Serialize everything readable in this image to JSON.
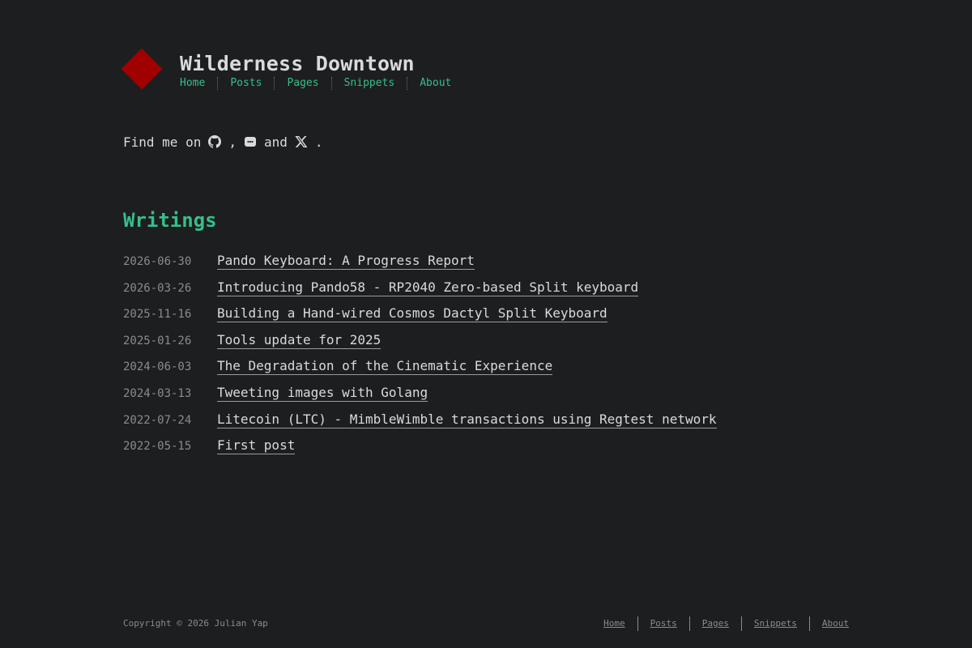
{
  "site": {
    "title": "Wilderness Downtown",
    "logo_color": "#a00000",
    "accent_color": "#35bf8a",
    "background_color": "#1d1e20"
  },
  "nav": {
    "items": [
      {
        "label": "Home"
      },
      {
        "label": "Posts"
      },
      {
        "label": "Pages"
      },
      {
        "label": "Snippets"
      },
      {
        "label": "About"
      }
    ]
  },
  "findme": {
    "prefix": "Find me on",
    "sep_comma": ",",
    "sep_and": "and",
    "suffix": ".",
    "icons": [
      "github-icon",
      "discord-icon",
      "x-icon"
    ]
  },
  "writings": {
    "heading": "Writings",
    "posts": [
      {
        "date": "2026-06-30",
        "title": "Pando Keyboard: A Progress Report"
      },
      {
        "date": "2026-03-26",
        "title": "Introducing Pando58 - RP2040 Zero-based Split keyboard"
      },
      {
        "date": "2025-11-16",
        "title": "Building a Hand-wired Cosmos Dactyl Split Keyboard"
      },
      {
        "date": "2025-01-26",
        "title": "Tools update for 2025"
      },
      {
        "date": "2024-06-03",
        "title": "The Degradation of the Cinematic Experience"
      },
      {
        "date": "2024-03-13",
        "title": "Tweeting images with Golang"
      },
      {
        "date": "2022-07-24",
        "title": "Litecoin (LTC) - MimbleWimble transactions using Regtest network"
      },
      {
        "date": "2022-05-15",
        "title": "First post"
      }
    ]
  },
  "footer": {
    "copyright": "Copyright © 2026 Julian Yap",
    "links": [
      {
        "label": "Home"
      },
      {
        "label": "Posts"
      },
      {
        "label": "Pages"
      },
      {
        "label": "Snippets"
      },
      {
        "label": "About"
      }
    ]
  }
}
